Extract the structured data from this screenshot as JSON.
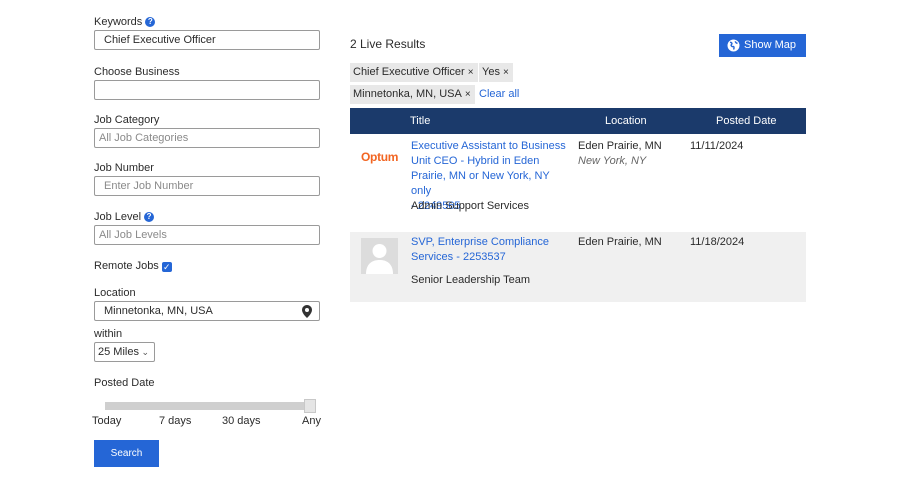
{
  "filters": {
    "keywords_label": "Keywords",
    "keywords_value": "Chief Executive Officer",
    "business_label": "Choose Business",
    "business_value": "",
    "category_label": "Job Category",
    "category_placeholder": "All Job Categories",
    "number_label": "Job Number",
    "number_placeholder": "Enter Job Number",
    "level_label": "Job Level",
    "level_placeholder": "All Job Levels",
    "remote_label": "Remote Jobs",
    "remote_checked": true,
    "location_label": "Location",
    "location_value": "Minnetonka, MN, USA",
    "within_label": "within",
    "within_value": "25 Miles",
    "posted_label": "Posted Date",
    "slider_ticks": [
      "Today",
      "7 days",
      "30 days",
      "Any"
    ],
    "slider_value": "Any",
    "search_label": "Search"
  },
  "results": {
    "count_text": "2 Live Results",
    "show_map_label": "Show Map",
    "chips": [
      "Chief Executive Officer",
      "Yes",
      "Minnetonka, MN, USA"
    ],
    "clear_all_label": "Clear all",
    "columns": [
      "Title",
      "Location",
      "Posted Date"
    ],
    "rows": [
      {
        "logo_text": "Optum",
        "title_lines": [
          "Executive Assistant to Business",
          "Unit CEO - Hybrid in Eden",
          "Prairie, MN or New York, NY only",
          "- 2249565"
        ],
        "category": "Admin Support Services",
        "location": "Eden Prairie, MN",
        "location_alt": "New York, NY",
        "date": "11/11/2024"
      },
      {
        "logo_text": "",
        "title_lines": [
          "SVP, Enterprise Compliance",
          "Services - 2253537"
        ],
        "category": "Senior Leadership Team",
        "location": "Eden Prairie, MN",
        "location_alt": "",
        "date": "11/18/2024"
      }
    ]
  },
  "colors": {
    "accent": "#2566d6",
    "header": "#1b3a6b",
    "brand_optum": "#f26522"
  }
}
